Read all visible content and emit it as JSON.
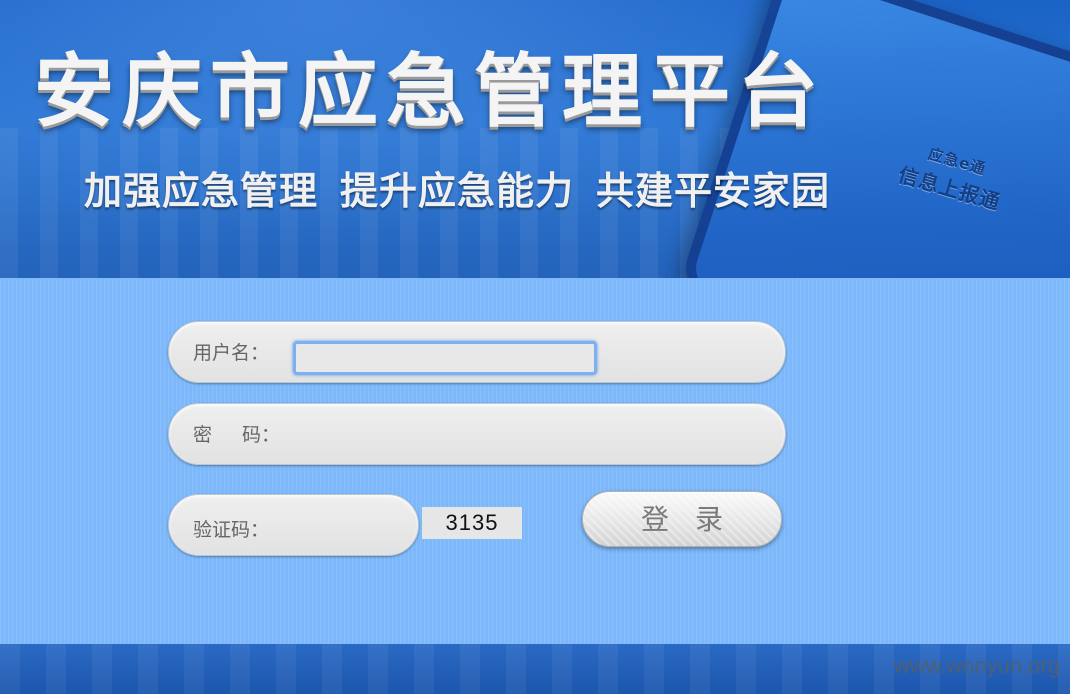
{
  "banner": {
    "title": "安庆市应急管理平台",
    "slogan": [
      "加强应急管理",
      "提升应急能力",
      "共建平安家园"
    ],
    "phone_caption": [
      "应急e通",
      "信息上报通"
    ]
  },
  "login_form": {
    "username_label": "用户名：",
    "username_value": "",
    "password_label_1": "密",
    "password_label_2": "码：",
    "password_value": "",
    "captcha_label": "验证码：",
    "captcha_value": "",
    "captcha_code": "3135",
    "login_button": "登录"
  },
  "footer": {
    "watermark": "www.wooyun.org"
  },
  "colors": {
    "banner_blue": "#2a74d2",
    "form_background": "#7db8fb",
    "input_pill": "#e6e6e6",
    "focus_ring": "#7cb0f2"
  }
}
